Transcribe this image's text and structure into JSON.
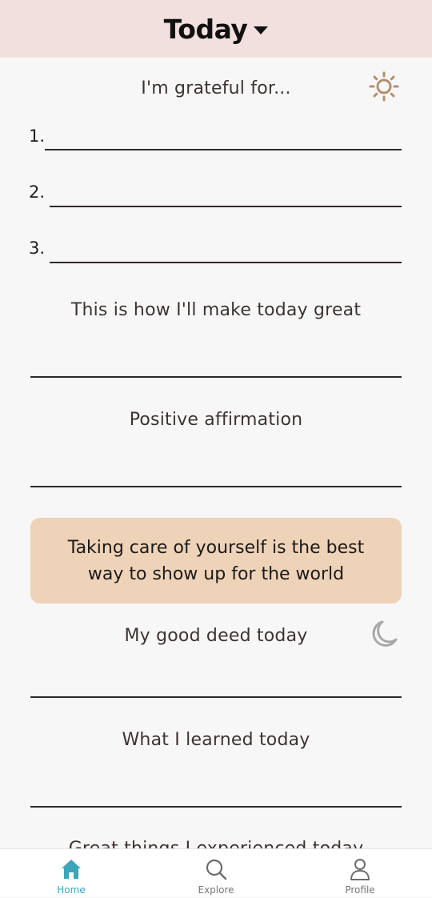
{
  "header": {
    "title": "Today"
  },
  "gratitude": {
    "title": "I'm grateful for...",
    "items": [
      {
        "num": "1."
      },
      {
        "num": "2."
      },
      {
        "num": "3."
      }
    ]
  },
  "sections": {
    "great_day": "This is how I'll make today great",
    "affirmation": "Positive affirmation",
    "good_deed": "My good deed today",
    "learned": "What I learned today",
    "great_things": "Great things I experienced today"
  },
  "quote": {
    "text": "Taking care of yourself is the best way to show up for the world"
  },
  "nav": {
    "home": "Home",
    "explore": "Explore",
    "profile": "Profile"
  },
  "colors": {
    "header_bg": "#f2e0df",
    "quote_bg": "#eed3b9",
    "accent": "#3aa6b9",
    "sun": "#b3906e",
    "moon": "#a8a8a8"
  },
  "icons": {
    "header_dropdown": "caret-down-icon",
    "morning": "sun-icon",
    "evening": "moon-icon",
    "home": "home-icon",
    "explore": "search-icon",
    "profile": "user-icon"
  }
}
